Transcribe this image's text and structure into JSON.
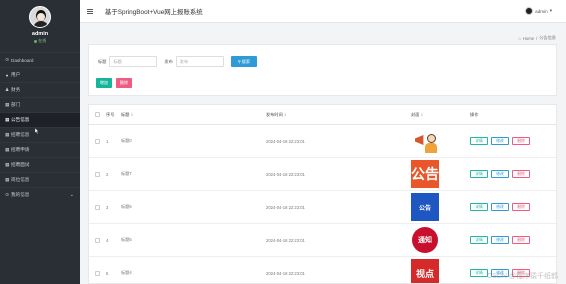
{
  "sidebar": {
    "username": "admin",
    "status": "在线",
    "items": [
      {
        "icon": "⊙",
        "label": "Dashboard"
      },
      {
        "icon": "●",
        "label": "用户"
      },
      {
        "icon": "♟",
        "label": "财务"
      },
      {
        "icon": "▦",
        "label": "部门"
      },
      {
        "icon": "▦",
        "label": "公告信息"
      },
      {
        "icon": "▦",
        "label": "招聘信息"
      },
      {
        "icon": "▦",
        "label": "招聘申请"
      },
      {
        "icon": "▦",
        "label": "招聘面试"
      },
      {
        "icon": "▦",
        "label": "岗位信息"
      },
      {
        "icon": "⊙",
        "label": "我的信息"
      }
    ]
  },
  "header": {
    "title": "基于SpringBoot+Vue网上报账系统",
    "user": "admin"
  },
  "breadcrumb": {
    "home": "Home",
    "sep": "/",
    "current": "公告信息"
  },
  "search": {
    "title_label": "标题",
    "title_placeholder": "标题",
    "date_label": "发布",
    "date_placeholder": "发布",
    "button": "搜索"
  },
  "actions": {
    "add": "增加",
    "delete": "删除"
  },
  "table": {
    "headers": {
      "index": "序号",
      "title": "标题",
      "time": "发布时间",
      "image": "封面",
      "ops": "操作"
    },
    "ops": {
      "view": "详情",
      "edit": "修改",
      "delete": "删除"
    },
    "rows": [
      {
        "index": "1",
        "title": "标题0",
        "time": "2024-04-18 22:23:01",
        "thumb": "喇叭",
        "thumb_style": "megaphone"
      },
      {
        "index": "2",
        "title": "标题7",
        "time": "2024-04-18 22:23:01",
        "thumb": "公告",
        "thumb_style": "orange"
      },
      {
        "index": "3",
        "title": "标题6",
        "time": "2024-04-18 22:23:01",
        "thumb": "公告",
        "thumb_style": "blue"
      },
      {
        "index": "4",
        "title": "标题5",
        "time": "2024-04-18 22:23:01",
        "thumb": "通知",
        "thumb_style": "seal"
      },
      {
        "index": "5",
        "title": "标题4",
        "time": "2024-04-18 22:23:01",
        "thumb": "视点",
        "thumb_style": "red"
      }
    ]
  },
  "watermark": "CSDN @程序猿千纸鹤"
}
